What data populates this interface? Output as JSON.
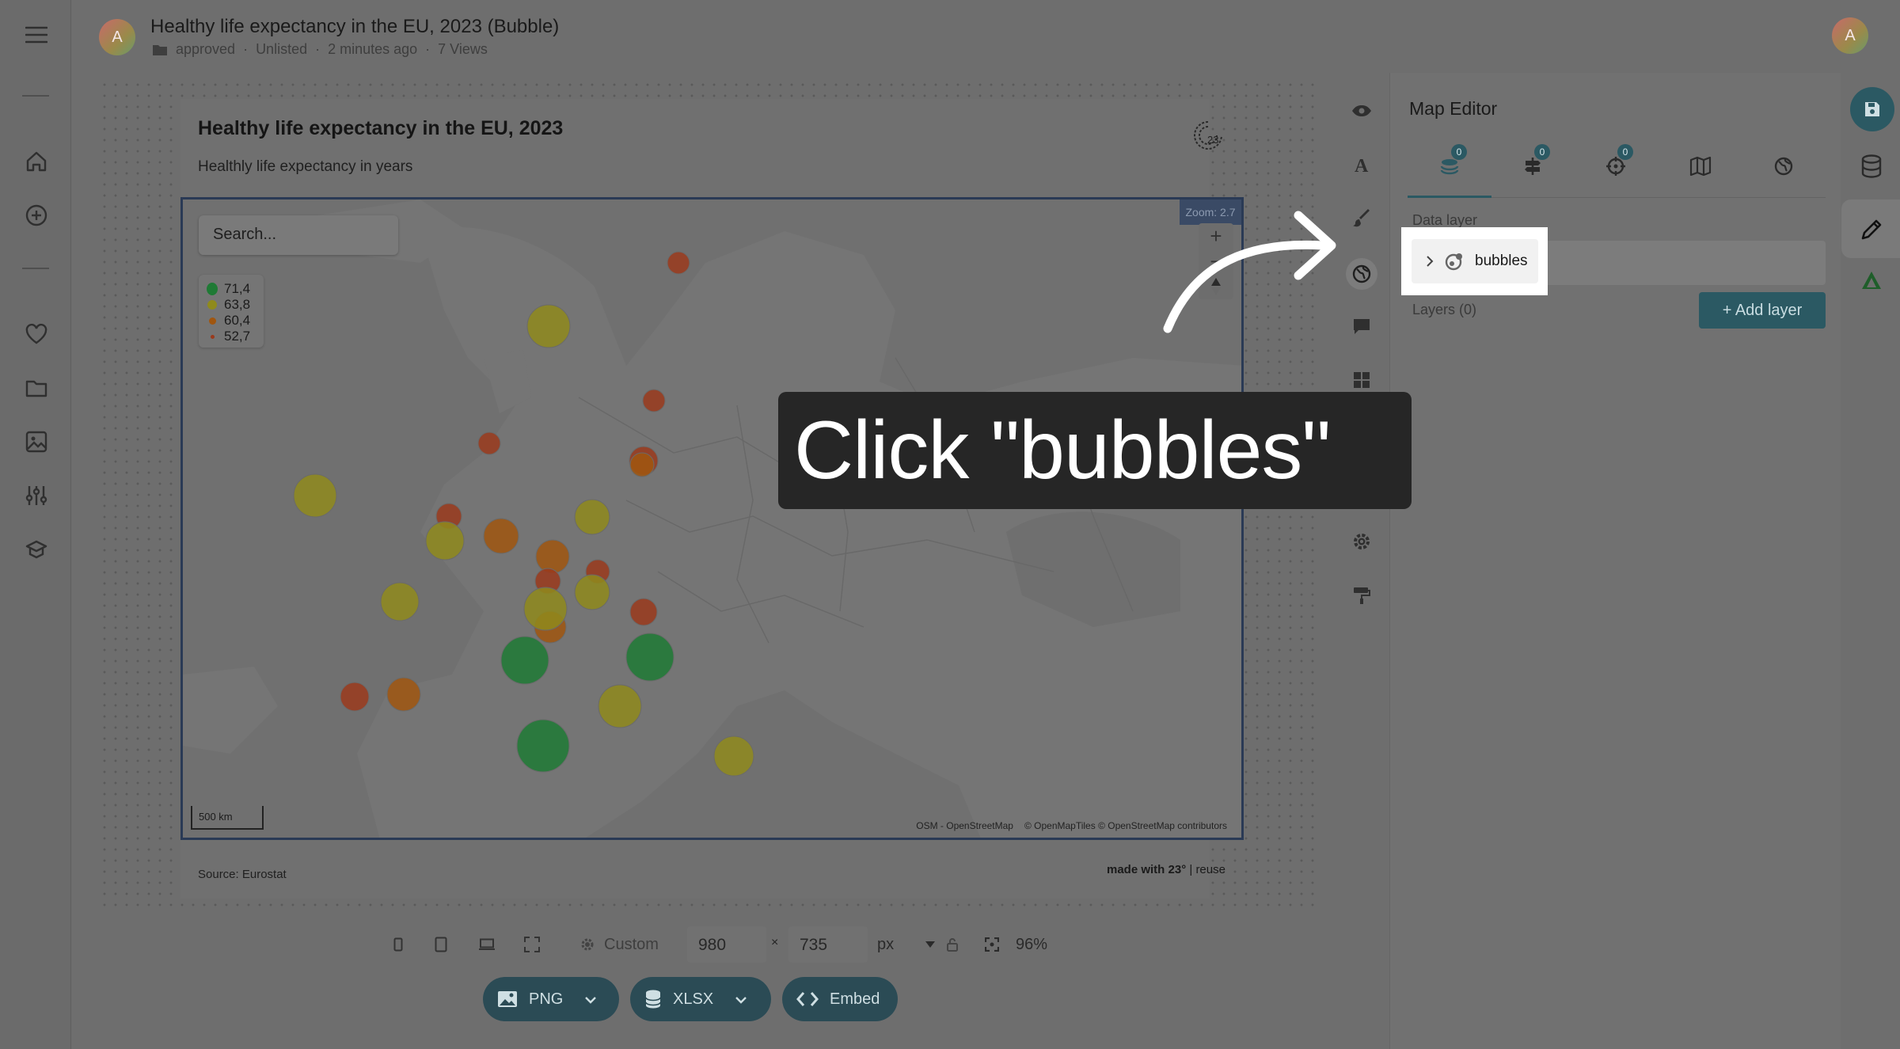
{
  "header": {
    "title": "Healthy life expectancy in the EU, 2023 (Bubble)",
    "avatar_letter": "A",
    "status": "approved",
    "visibility": "Unlisted",
    "updated": "2 minutes ago",
    "views": "7 Views"
  },
  "chart": {
    "title": "Healthy life expectancy in the EU, 2023",
    "subtitle": "Healthly life expectancy in years",
    "logo_text": "23",
    "search_placeholder": "Search...",
    "zoom_label": "Zoom: 2.7",
    "scale_label": "500 km",
    "attribution": [
      "OSM - OpenStreetMap",
      "© OpenMapTiles © OpenStreetMap contributors"
    ],
    "source": "Source: Eurostat",
    "made_with": "made with 23°",
    "reuse": "reuse",
    "legend": [
      {
        "label": "71,4",
        "color": "#1f7a35"
      },
      {
        "label": "63,8",
        "color": "#8f8a1c"
      },
      {
        "label": "60,4",
        "color": "#a0560f"
      },
      {
        "label": "52,7",
        "color": "#9a3a1c"
      }
    ]
  },
  "toolbar": {
    "size_preset": "Custom",
    "width": "980",
    "height": "735",
    "unit": "px",
    "zoom": "96%",
    "png_label": "PNG",
    "xlsx_label": "XLSX",
    "embed_label": "Embed"
  },
  "panel": {
    "title": "Map Editor",
    "tab_badges": [
      "0",
      "0",
      "0"
    ],
    "data_layer_label": "Data layer",
    "selected_layer": "bubbles",
    "layers_count": "Layers (0)",
    "add_layer_label": "+ Add layer"
  },
  "tooltip": {
    "text": "Click \"bubbles\""
  },
  "colors": {
    "accent": "#2b5963",
    "bubble_green": "#1f7a35",
    "bubble_olive": "#8f8a1c",
    "bubble_orange": "#a0560f",
    "bubble_red": "#9a3a1c"
  }
}
